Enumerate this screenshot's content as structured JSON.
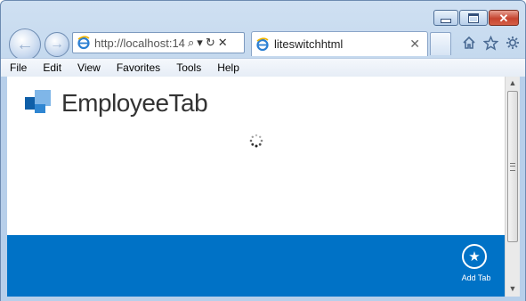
{
  "window": {
    "close_glyph": "✕"
  },
  "nav": {
    "back_glyph": "←",
    "forward_glyph": "→",
    "address_value": "http://localhost:14",
    "address_controls": [
      "⌕",
      "▾",
      "↻",
      "✕"
    ]
  },
  "tab": {
    "title": "liteswitchhtml",
    "close_glyph": "✕"
  },
  "toolbar_icons": [
    "home-icon",
    "favorites-star-icon",
    "tools-gear-icon"
  ],
  "menu": {
    "items": [
      "File",
      "Edit",
      "View",
      "Favorites",
      "Tools",
      "Help"
    ]
  },
  "page": {
    "app_title": "EmployeeTab",
    "add_tab_label": "Add Tab",
    "add_tab_glyph": "★",
    "accent_color": "#0072c6"
  },
  "scrollbar": {
    "up_glyph": "▲",
    "down_glyph": "▼"
  }
}
